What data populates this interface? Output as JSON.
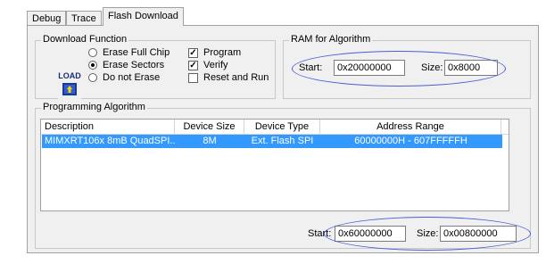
{
  "tabs": [
    {
      "label": "Debug"
    },
    {
      "label": "Trace"
    },
    {
      "label": "Flash Download",
      "active": true
    }
  ],
  "download_function": {
    "title": "Download Function",
    "logo_text": "LOAD",
    "options": [
      {
        "label": "Erase Full Chip",
        "selected": false
      },
      {
        "label": "Erase Sectors",
        "selected": true
      },
      {
        "label": "Do not Erase",
        "selected": false
      }
    ],
    "checks": [
      {
        "label": "Program",
        "checked": true
      },
      {
        "label": "Verify",
        "checked": true
      },
      {
        "label": "Reset and Run",
        "checked": false
      }
    ]
  },
  "ram": {
    "title": "RAM for Algorithm",
    "start_label": "Start:",
    "start_value": "0x20000000",
    "size_label": "Size:",
    "size_value": "0x8000"
  },
  "programming": {
    "title": "Programming Algorithm",
    "columns": [
      "Description",
      "Device Size",
      "Device Type",
      "Address Range"
    ],
    "rows": [
      {
        "description": "MIMXRT106x 8mB QuadSPI...",
        "size": "8M",
        "type": "Ext. Flash SPI",
        "range": "60000000H - 607FFFFFH"
      }
    ],
    "start_label": "Start:",
    "start_value": "0x60000000",
    "size_label": "Size:",
    "size_value": "0x00800000"
  },
  "colors": {
    "selection": "#3399ff",
    "highlight_ellipse": "#4a5fd6"
  },
  "icons": {
    "check": "checkmark-icon",
    "logo": "load-logo-icon"
  }
}
